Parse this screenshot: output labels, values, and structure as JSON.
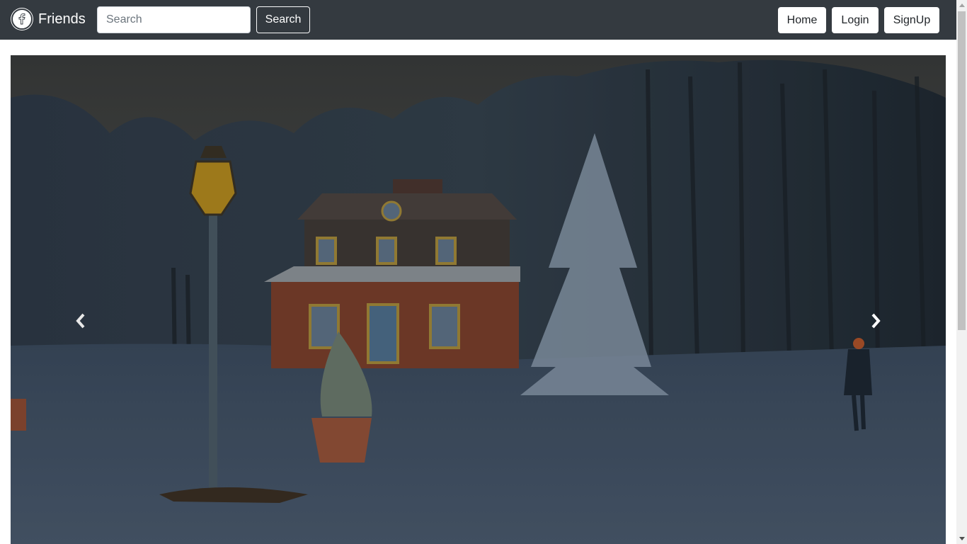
{
  "navbar": {
    "brand": "Friends",
    "search_placeholder": "Search",
    "search_button": "Search",
    "links": {
      "home": "Home",
      "login": "Login",
      "signup": "SignUp"
    }
  },
  "carousel": {
    "image_alt": "Snowy winter park with a brick house and lamp post",
    "prev_icon": "chevron-left-icon",
    "next_icon": "chevron-right-icon"
  },
  "colors": {
    "navbar_bg": "#343a40",
    "text_light": "#ffffff"
  }
}
